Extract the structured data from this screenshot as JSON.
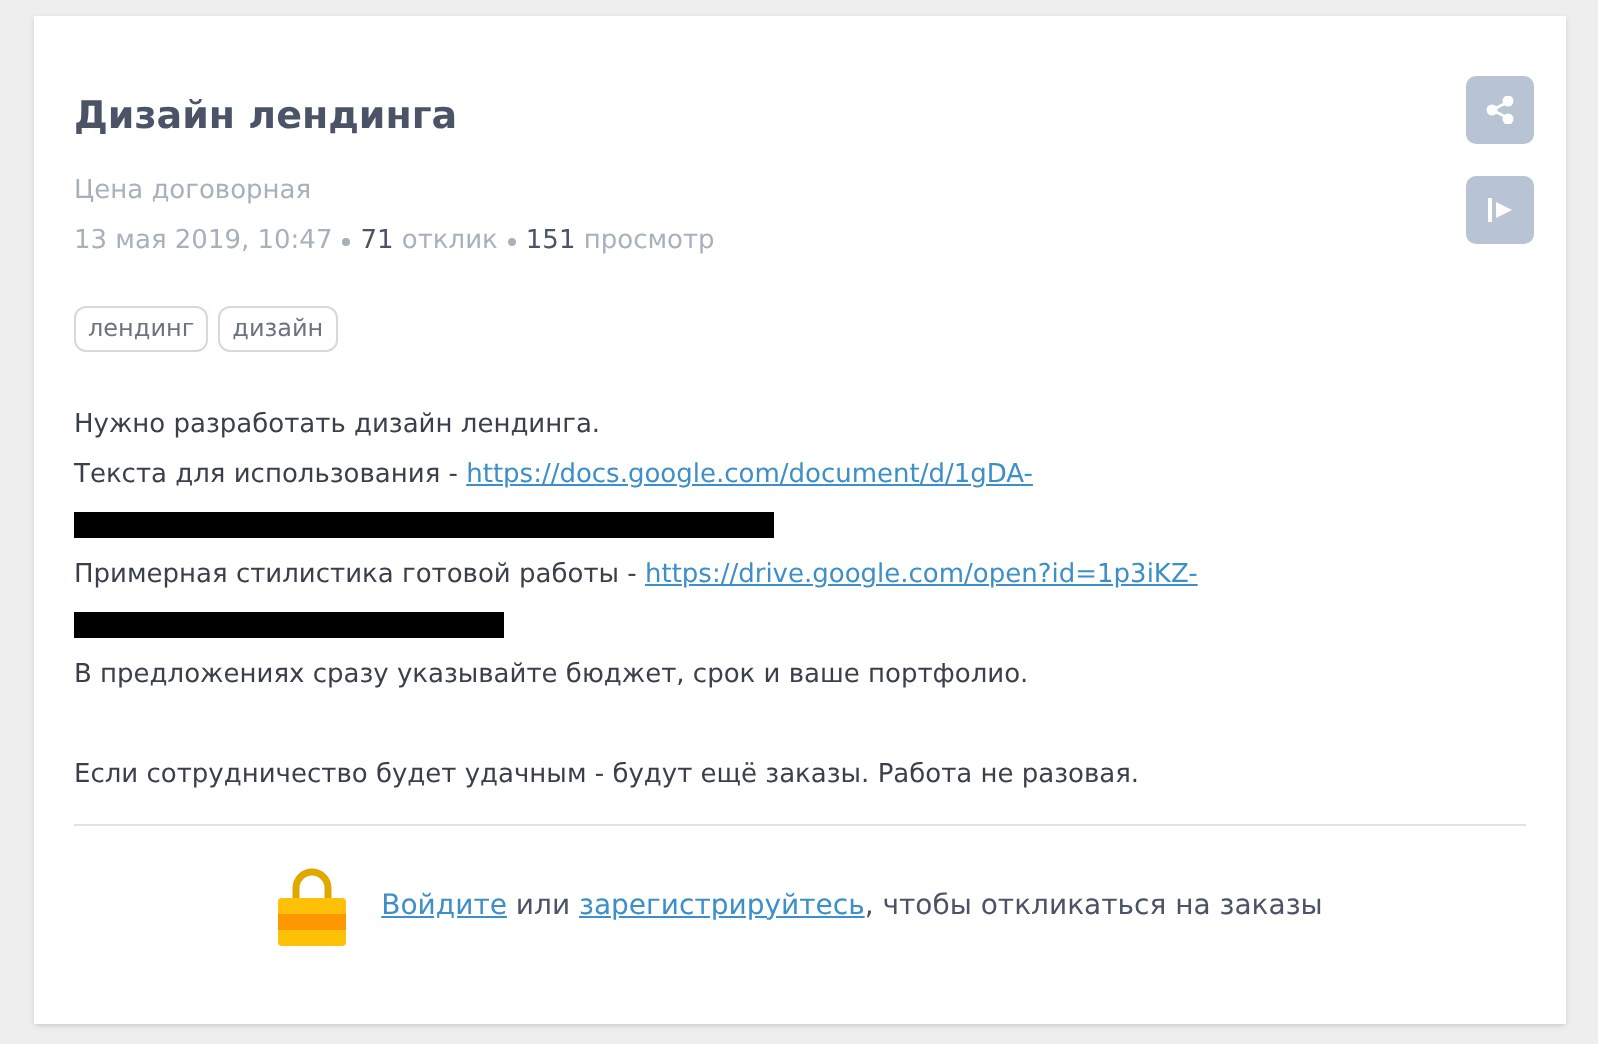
{
  "order": {
    "title": "Дизайн лендинга",
    "price": "Цена договорная",
    "date": "13 мая 2019, 10:47",
    "responses_count": "71",
    "responses_label": "отклик",
    "views_count": "151",
    "views_label": "просмотр"
  },
  "tags": [
    "лендинг",
    "дизайн"
  ],
  "description": [
    {
      "kind": "text",
      "text": "Нужно разработать дизайн лендинга."
    },
    {
      "kind": "link",
      "text": "Текста для использования - ",
      "link": "https://docs.google.com/document/d/1gDA-"
    },
    {
      "kind": "longredaction"
    },
    {
      "kind": "link",
      "text": "Примерная стилистика готовой работы - ",
      "link": "https://drive.google.com/open?id=1p3iKZ-"
    },
    {
      "kind": "shortredaction"
    },
    {
      "kind": "text",
      "text": "В предложениях сразу указывайте бюджет, срок и ваше портфолио."
    },
    {
      "kind": "gap"
    },
    {
      "kind": "text",
      "text": "Если сотрудничество будет удачным - будут ещё заказы. Работа не разовая."
    }
  ],
  "footer": {
    "login_link": "Войдите",
    "middle": " или ",
    "register_link": "зарегистрируйтесь",
    "tail": ", чтобы откликаться на заказы"
  }
}
